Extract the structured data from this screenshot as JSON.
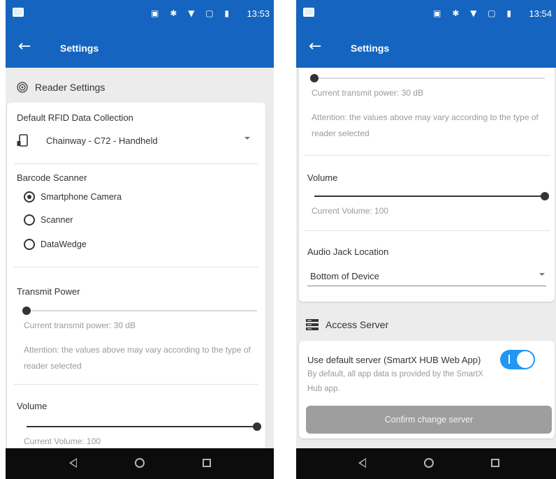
{
  "screens": [
    {
      "status": {
        "time": "13:53",
        "icons": "▣ ✱ ▼ ▢ ▮"
      },
      "appbar": {
        "back": "←",
        "title": "Settings"
      },
      "reader_section": {
        "title": "Reader Settings",
        "rfid": {
          "label": "Default RFID Data Collection",
          "value": "Chainway - C72 - Handheld"
        },
        "barcode": {
          "label": "Barcode Scanner",
          "options": [
            "Smartphone Camera",
            "Scanner",
            "DataWedge"
          ],
          "selected": 0
        },
        "transmit": {
          "label": "Transmit Power",
          "level": 0.0,
          "current": "Current transmit power: 30 dB",
          "attention": "Attention: the values above may vary according to the type of reader selected"
        },
        "volume": {
          "label": "Volume",
          "level": 1.0,
          "current": "Current Volume: 100"
        }
      }
    },
    {
      "status": {
        "time": "13:54",
        "icons": "▣ ✱ ▼ ▢ ▮"
      },
      "appbar": {
        "back": "←",
        "title": "Settings"
      },
      "reader_section": {
        "transmit": {
          "level": 0.0,
          "current": "Current transmit power: 30 dB",
          "attention": "Attention: the values above may vary according to the type of reader selected"
        },
        "volume": {
          "label": "Volume",
          "level": 1.0,
          "current": "Current Volume: 100"
        },
        "audio_jack": {
          "label": "Audio Jack Location",
          "value": "Bottom of Device"
        }
      },
      "server_section": {
        "title": "Access Server",
        "default_server": {
          "label": "Use default server (SmartX HUB Web App)",
          "enabled": true,
          "description": "By default, all app data is provided by the SmartX Hub app."
        },
        "confirm_button": "Confirm change server"
      }
    }
  ],
  "colors": {
    "primary": "#1565c0",
    "toggle": "#2196f3",
    "button_disabled": "#9e9e9e",
    "navbar": "#0c0c0c"
  },
  "icons": {
    "notification": "notification-icon",
    "back": "arrow-back-icon",
    "reader": "rfid-reader-icon",
    "device": "handheld-device-icon",
    "server": "server-icon"
  }
}
